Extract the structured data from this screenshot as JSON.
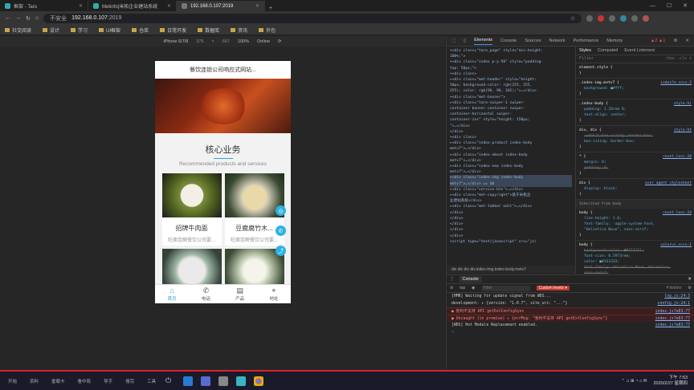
{
  "browser": {
    "tabs": [
      {
        "title": "框架 - Taro",
        "active": false
      },
      {
        "title": "Metinfo|米拓企业建站系统",
        "active": false
      },
      {
        "title": "192.168.0.107:2019",
        "active": true
      }
    ],
    "address": {
      "insecure": "不安全",
      "host": "192.168.0.107",
      "port": ":2019"
    },
    "bookmarks": [
      "社交阅读",
      "设计",
      "学习",
      "UI框架",
      "仓库",
      "日常开发",
      "数据库",
      "资讯",
      "外包"
    ]
  },
  "device": {
    "name": "iPhone 6/7/8",
    "w": "375",
    "h": "667",
    "zoom": "100%",
    "net": "Online"
  },
  "phone": {
    "header": "餐饮连锁公司响应式网站...",
    "section_title": "核心业务",
    "section_sub": "Recommended products and services",
    "cards": [
      {
        "title": "招牌牛肉面",
        "desc": "吃面连瞬餐饮公司要..."
      },
      {
        "title": "豆腐腐竹木...",
        "desc": "吃面连瞬餐饮公司要..."
      }
    ],
    "nav": [
      {
        "icon": "⌂",
        "label": "首页",
        "on": true
      },
      {
        "icon": "✆",
        "label": "电话",
        "on": false
      },
      {
        "icon": "▤",
        "label": "产品",
        "on": false
      },
      {
        "icon": "⌖",
        "label": "地址",
        "on": false
      }
    ]
  },
  "devtools": {
    "tabs": [
      "Elements",
      "Console",
      "Sources",
      "Network",
      "Performance",
      "Memory"
    ],
    "errors": "▲2 ▲1",
    "elements": [
      "▾<div class=\"taro_page\" style=\"min-height:",
      "  100%;\">",
      "  ▾<div class=\"index p-y-50\" style=\"padding-",
      "   top: 50px;\">",
      "    ▾<div class>",
      "      ▸<div class=\"met-header\" style=\"height:",
      "       50px; background-color: rgb(255, 255,",
      "       255); color: rgb(96, 98, 102);\">…</div>",
      "      ▾<div class=\"met-banner\">",
      "        ▸<div class=\"taro-swiper-1 swiper-",
      "         container banner-container swiper-",
      "         container-horizontal swiper-",
      "         container-ios\" style=\"height: 150px;",
      "         \">…</div>",
      "        </div>",
      "      ▾<div class>",
      "        ▸<div class=\"index-product index-body",
      "         metv7\">…</div>",
      "        ▸<div class=\"index-about index-body",
      "         metv7\">…</div>",
      "        ▸<div class=\"index-new index-body",
      "         metv7\">…</div>",
      "        ▸<div class=\"index-img index-body",
      "         metv7\">…</div> == $0",
      "        ▸<div class=\"service-btn\">…</div>",
      "        ▸<div class=\"met-copyright\">基于米拓企",
      "         业建站系统</div>",
      "        ▸<div class=\"met-tabbar edit\">…</div>",
      "      </div>",
      "    </div>",
      "   </div>",
      "  </div>",
      " </div>",
      " <script type=\"text/javascript\" src=\"js/"
    ],
    "highlight_index": 23,
    "crumbs": "div  div  div  div.index-img.index-body.metv7",
    "styles_tabs": [
      "Styles",
      "Computed",
      "Event Listeners"
    ],
    "filter": "Filter",
    "rules": [
      {
        "sel": "element.style {",
        "src": "",
        "props": []
      },
      {
        "sel": ".index-img.metv7 {",
        "src": "index?e.scss:2",
        "props": [
          {
            "t": "background: ■#fff;",
            "s": false
          }
        ]
      },
      {
        "sel": ".index-body {",
        "src": "style:hi",
        "props": [
          {
            "t": "padding: 1.28rem 0;",
            "s": false
          },
          {
            "t": "text-align: center;",
            "s": false
          }
        ]
      },
      {
        "sel": "div, div {",
        "src": "style:ht",
        "props": [
          {
            "t": "-webkit-box-sizing: border-box;",
            "s": true
          },
          {
            "t": "box-sizing: border-box;",
            "s": false
          }
        ]
      },
      {
        "sel": "* {",
        "src": "reset.less:28",
        "props": [
          {
            "t": "margin: 0;",
            "s": false
          },
          {
            "t": "padding: 0;",
            "s": true
          }
        ]
      },
      {
        "sel": "div {",
        "src": "user agent stylesheet",
        "props": [
          {
            "t": "display: block;",
            "s": false
          }
        ]
      }
    ],
    "inherited": "Inherited from body",
    "rules2": [
      {
        "sel": "body {",
        "src": "reset.less:24",
        "props": [
          {
            "t": "line-height: 1.6;",
            "s": false
          },
          {
            "t": "font-family: -apple-system-font,",
            "s": false
          },
          {
            "t": "\"Helvetica Neue\", sans-serif;",
            "s": false
          }
        ]
      },
      {
        "sel": "body {",
        "src": "colorui.scss:1",
        "props": [
          {
            "t": "background-color: ■#f1f1f1;",
            "s": true
          },
          {
            "t": "font-size: 0.5973rem;",
            "s": false
          },
          {
            "t": "color: ■#333333;",
            "s": false
          },
          {
            "t": "font-family: Helvetica Neue, Helvetica,",
            "s": true
          },
          {
            "t": "sans-serif;",
            "s": true
          },
          {
            "t": "-webkit-box-sizing: border-box;",
            "s": true
          },
          {
            "t": "box-sizing: border-box;",
            "s": true
          }
        ]
      }
    ],
    "console": {
      "title": "Console",
      "context": "top",
      "filter": "Filter",
      "levels": "Custom levels ▾",
      "hidden": "4 hidden",
      "messages": [
        {
          "t": "[HMR] Waiting for update signal from WDS...",
          "src": "log.js:24:3",
          "err": false
        },
        {
          "t": "development: ▸ {version: \"1.0.7\", site_uri: \"...\"}",
          "src": "config.js:24:1",
          "err": false
        },
        {
          "t": "● 暂时不支持 API getExtConfigSync",
          "src": "index.js?e83:77",
          "err": true
        },
        {
          "t": "● Uncaught (in promise) ▸ {errMsg: \"暂时不支持 API getExtConfigSync\"}",
          "src": "index.js?e83:77",
          "err": true
        },
        {
          "t": "[WDS] Hot Module Replacement enabled.",
          "src": "index.js?e83:77",
          "err": false
        }
      ]
    }
  },
  "taskbar": {
    "items": [
      "开始",
      "资料",
      "垂载卡",
      "看中局",
      "导手",
      "搜完",
      "工具"
    ],
    "time": "下午 7:53",
    "date": "2020/2/27 星期四"
  }
}
